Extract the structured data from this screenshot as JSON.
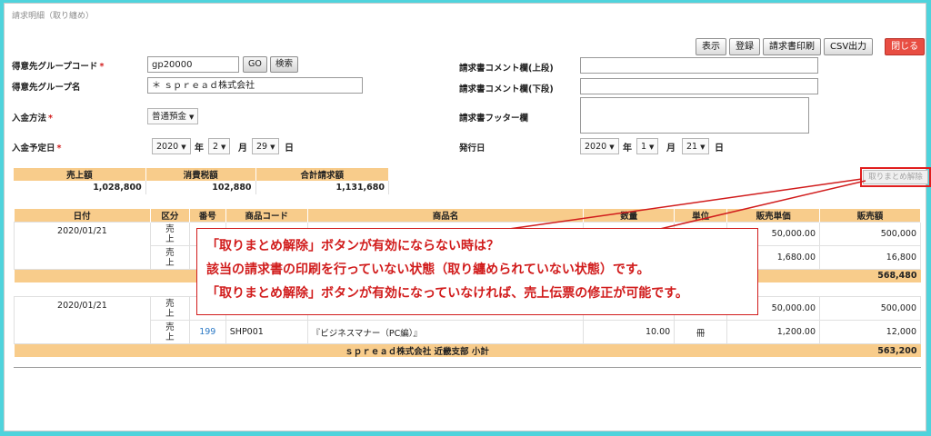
{
  "page": {
    "title": "請求明細（取り纏め）"
  },
  "toolbar": {
    "show": "表示",
    "register": "登録",
    "print": "請求書印刷",
    "csv": "CSV出力",
    "close": "閉じる"
  },
  "form": {
    "group_code_label": "得意先グループコード",
    "group_code_value": "gp20000",
    "go_label": "GO",
    "search_label": "検索",
    "group_name_label": "得意先グループ名",
    "group_name_value": "＊ ｓｐｒｅａｄ株式会社",
    "payment_label": "入金方法",
    "payment_value": "普通預金",
    "due_label": "入金予定日",
    "due_year": "2020",
    "due_month": "2",
    "due_day": "29",
    "comment_top_label": "請求書コメント欄(上段)",
    "comment_bottom_label": "請求書コメント欄(下段)",
    "footer_label": "請求書フッター欄",
    "issue_label": "発行日",
    "issue_year": "2020",
    "issue_month": "1",
    "issue_day": "21",
    "year_unit": "年",
    "month_unit": "月",
    "day_unit": "日",
    "required_mark": "*"
  },
  "totals": {
    "headers": [
      "売上額",
      "消費税額",
      "合計請求額"
    ],
    "values": [
      "1,028,800",
      "102,880",
      "1,131,680"
    ]
  },
  "release_button": "取りまとめ解除",
  "detail": {
    "headers": [
      "日付",
      "区分",
      "番号",
      "商品コード",
      "商品名",
      "数量",
      "単位",
      "販売単価",
      "販売額"
    ],
    "group1": {
      "date": "2020/01/21",
      "row1": {
        "kubun": "売\n上",
        "price": "50,000.00",
        "amount": "500,000"
      },
      "row2": {
        "kubun": "売\n上",
        "price": "1,680.00",
        "amount": "16,800"
      },
      "subtotal": "568,480"
    },
    "group2": {
      "date": "2020/01/21",
      "row1": {
        "kubun": "売\n上",
        "price": "50,000.00",
        "amount": "500,000"
      },
      "row2": {
        "kubun": "売\n上",
        "number": "199",
        "code": "SHP001",
        "name": "『ビジネスマナー（PC編）』",
        "qty": "10.00",
        "unit": "冊",
        "price": "1,200.00",
        "amount": "12,000"
      },
      "subtotal_label": "ｓｐｒｅａｄ株式会社 近畿支部 小計",
      "subtotal": "563,200"
    }
  },
  "callout": {
    "line1": "「取りまとめ解除」ボタンが有効にならない時は？",
    "line2": "該当の請求書の印刷を行っていない状態（取り纏められていない状態）です。",
    "line3": "「取りまとめ解除」ボタンが有効になっていなければ、売上伝票の修正が可能です。"
  },
  "colors": {
    "accent": "#f8cc8b",
    "annotation": "#d11c1c",
    "background": "#4fd3dc"
  }
}
